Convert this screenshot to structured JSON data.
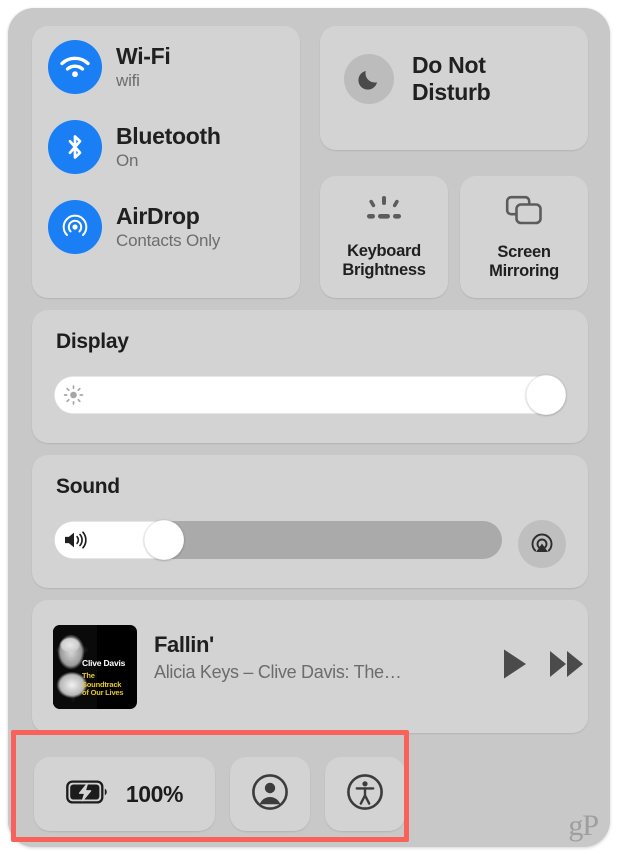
{
  "window": {
    "name": "macos-control-center",
    "background_color": "#c8c8c8",
    "tile_color": "#d3d3d3",
    "accent_blue": "#1a7ef5"
  },
  "toggles": {
    "items": [
      {
        "icon": "wifi-icon",
        "title": "Wi-Fi",
        "subtitle": "wifi"
      },
      {
        "icon": "bluetooth-icon",
        "title": "Bluetooth",
        "subtitle": "On"
      },
      {
        "icon": "airdrop-icon",
        "title": "AirDrop",
        "subtitle": "Contacts Only"
      }
    ]
  },
  "do_not_disturb": {
    "icon": "moon-icon",
    "label": "Do Not\nDisturb"
  },
  "keyboard_brightness": {
    "icon": "keyboard-brightness-icon",
    "label": "Keyboard\nBrightness"
  },
  "screen_mirroring": {
    "icon": "screen-mirroring-icon",
    "label": "Screen\nMirroring"
  },
  "display": {
    "title": "Display",
    "icon": "brightness-icon",
    "value_percent": 100
  },
  "sound": {
    "title": "Sound",
    "icon": "speaker-icon",
    "value_percent": 22,
    "airplay_icon": "airplay-icon"
  },
  "now_playing": {
    "album_art": {
      "title": "Clive Davis",
      "subtitle": "The Soundtrack\nof Our Lives"
    },
    "song_title": "Fallin'",
    "song_subtitle": "Alicia Keys – Clive Davis: The…",
    "play_icon": "play-icon",
    "next_icon": "fast-forward-icon"
  },
  "bottom_bar": {
    "battery": {
      "icon": "battery-charging-icon",
      "percent_label": "100%"
    },
    "user": {
      "icon": "user-account-icon"
    },
    "accessibility": {
      "icon": "accessibility-icon"
    }
  },
  "highlight": {
    "color": "#f9615b"
  },
  "watermark": {
    "text": "gP"
  }
}
